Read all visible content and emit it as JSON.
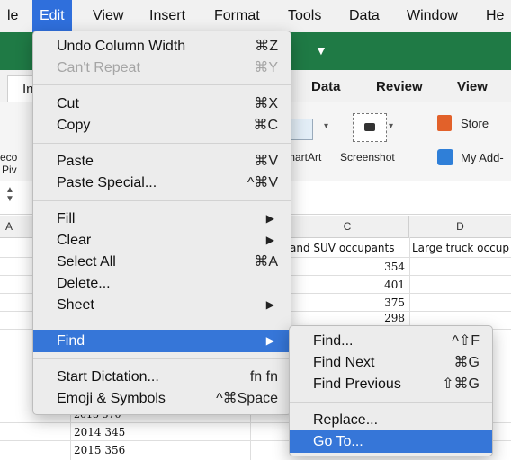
{
  "menubar": {
    "items": [
      "le",
      "Edit",
      "View",
      "Insert",
      "Format",
      "Tools",
      "Data",
      "Window",
      "He"
    ]
  },
  "ribbon": {
    "tabs": [
      "In",
      "Data",
      "Review",
      "View"
    ],
    "labels": {
      "smartart": "martArt",
      "screenshot": "Screenshot",
      "store": "Store",
      "addins": "My Add-",
      "pivot_line1": "eco",
      "pivot_line2": "Piv"
    }
  },
  "sheet": {
    "col_a": "A",
    "col_c": "C",
    "col_d": "D",
    "header_c": "and SUV occupants",
    "header_d": "Large truck occup",
    "c_values": [
      "354",
      "401",
      "375",
      "298"
    ],
    "b_rows": [
      "2013 370",
      "2014 345",
      "2015 356"
    ]
  },
  "edit_menu": {
    "undo": {
      "label": "Undo Column Width",
      "shortcut": "⌘Z"
    },
    "repeat": {
      "label": "Can't Repeat",
      "shortcut": "⌘Y"
    },
    "cut": {
      "label": "Cut",
      "shortcut": "⌘X"
    },
    "copy": {
      "label": "Copy",
      "shortcut": "⌘C"
    },
    "paste": {
      "label": "Paste",
      "shortcut": "⌘V"
    },
    "paste_special": {
      "label": "Paste Special...",
      "shortcut": "^⌘V"
    },
    "fill": {
      "label": "Fill"
    },
    "clear": {
      "label": "Clear"
    },
    "select_all": {
      "label": "Select All",
      "shortcut": "⌘A"
    },
    "delete": {
      "label": "Delete..."
    },
    "sheet": {
      "label": "Sheet"
    },
    "find": {
      "label": "Find"
    },
    "dictation": {
      "label": "Start Dictation...",
      "shortcut": "fn fn"
    },
    "emoji": {
      "label": "Emoji & Symbols",
      "shortcut": "^⌘Space"
    }
  },
  "find_menu": {
    "find": {
      "label": "Find...",
      "shortcut": "^⇧F"
    },
    "find_next": {
      "label": "Find Next",
      "shortcut": "⌘G"
    },
    "find_previous": {
      "label": "Find Previous",
      "shortcut": "⇧⌘G"
    },
    "replace": {
      "label": "Replace..."
    },
    "goto": {
      "label": "Go To..."
    }
  },
  "colors": {
    "menu_highlight": "#3676d8",
    "excel_green": "#1f7a45",
    "menubar_active": "#2f6fdc"
  }
}
